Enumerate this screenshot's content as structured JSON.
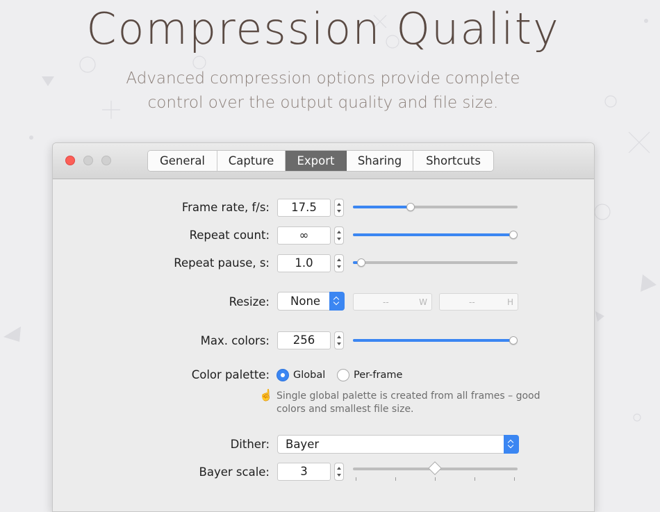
{
  "hero": {
    "title": "Compression Quality",
    "subtitle_line1": "Advanced compression options provide complete",
    "subtitle_line2": "control over the output quality and file size."
  },
  "window": {
    "tabs": [
      {
        "label": "General",
        "active": false
      },
      {
        "label": "Capture",
        "active": false
      },
      {
        "label": "Export",
        "active": true
      },
      {
        "label": "Sharing",
        "active": false
      },
      {
        "label": "Shortcuts",
        "active": false
      }
    ]
  },
  "form": {
    "frame_rate": {
      "label": "Frame rate, f/s:",
      "value": "17.5",
      "slider_fraction": 0.35
    },
    "repeat_count": {
      "label": "Repeat count:",
      "value": "∞",
      "slider_fraction": 1.0
    },
    "repeat_pause": {
      "label": "Repeat pause, s:",
      "value": "1.0",
      "slider_fraction": 0.05
    },
    "resize": {
      "label": "Resize:",
      "value": "None",
      "width_placeholder": "--",
      "width_unit": "W",
      "height_placeholder": "--",
      "height_unit": "H"
    },
    "max_colors": {
      "label": "Max. colors:",
      "value": "256",
      "slider_fraction": 1.0
    },
    "color_palette": {
      "label": "Color palette:",
      "options": [
        "Global",
        "Per-frame"
      ],
      "selected": "Global"
    },
    "hint_icon": "☝️",
    "hint_line1": "Single global palette is created from all frames – good",
    "hint_line2": "colors and smallest file size.",
    "dither": {
      "label": "Dither:",
      "value": "Bayer"
    },
    "bayer_scale": {
      "label": "Bayer scale:",
      "value": "3",
      "slider_fraction": 0.5,
      "ticks": 5
    }
  },
  "colors": {
    "accent": "#3b86f2",
    "close": "#fc5f57",
    "hero_title": "#5a4a43"
  }
}
